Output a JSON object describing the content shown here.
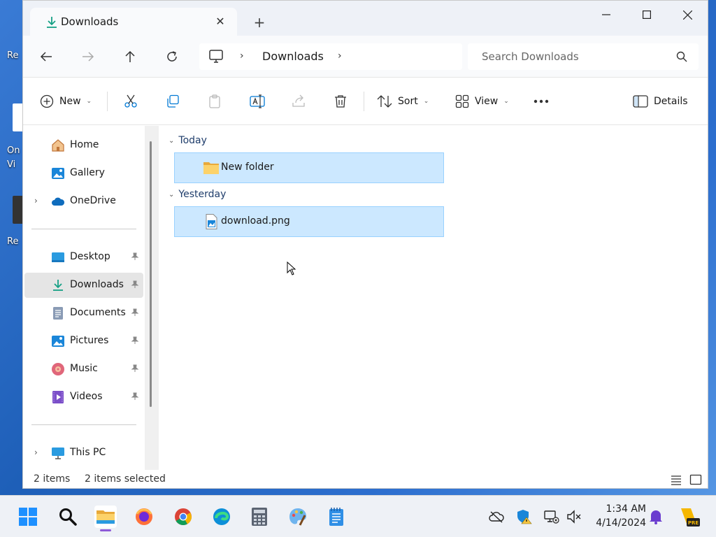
{
  "desktop": {
    "icon1_label": "Re",
    "icon2_label": "On Vi",
    "icon3_label": "Re"
  },
  "window": {
    "tab_title": "Downloads",
    "breadcrumb": "Downloads",
    "search_placeholder": "Search Downloads"
  },
  "commands": {
    "new_label": "New",
    "sort_label": "Sort",
    "view_label": "View",
    "details_label": "Details"
  },
  "sidebar": {
    "home": "Home",
    "gallery": "Gallery",
    "onedrive": "OneDrive",
    "desktop": "Desktop",
    "downloads": "Downloads",
    "documents": "Documents",
    "pictures": "Pictures",
    "music": "Music",
    "videos": "Videos",
    "thispc": "This PC"
  },
  "content": {
    "groups": [
      {
        "label": "Today",
        "items": [
          {
            "name": "New folder",
            "type": "folder"
          }
        ]
      },
      {
        "label": "Yesterday",
        "items": [
          {
            "name": "download.png",
            "type": "image"
          }
        ]
      }
    ]
  },
  "status": {
    "count": "2 items",
    "selected": "2 items selected"
  },
  "taskbar": {
    "time": "1:34 AM",
    "date": "4/14/2024"
  },
  "colors": {
    "selection": "#cce8ff",
    "selection_border": "#99d1ff",
    "accent": "#0078d4",
    "download_green": "#16a085"
  }
}
